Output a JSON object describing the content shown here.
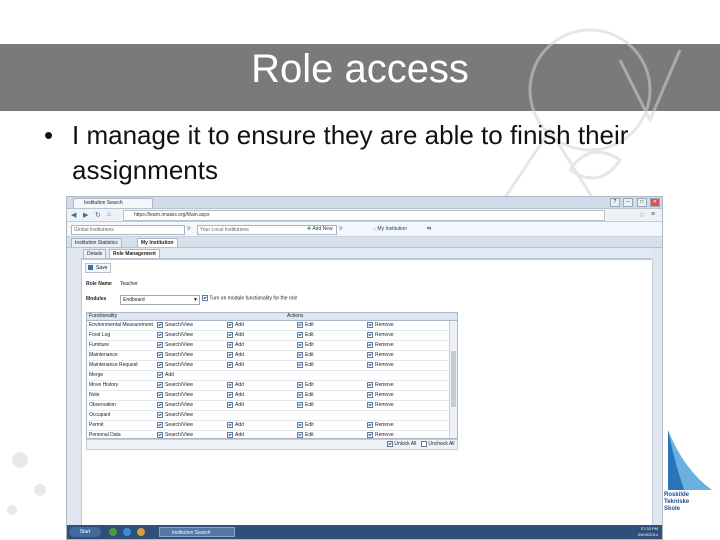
{
  "slide": {
    "title": "Role access",
    "bullet_text": "I manage it to ensure they are able to finish their assignments",
    "logo_lines": [
      "Roskilde",
      "Tekniske",
      "Skole"
    ]
  },
  "browser": {
    "tab_label": "Institution Search",
    "url": "https://learn.imaisis.org/Main.aspx",
    "window_buttons": [
      "?",
      "–",
      "□",
      "✕"
    ]
  },
  "app": {
    "search_global_placeholder": "Global Institutions",
    "search_local_placeholder": "Your Local Institutions",
    "add_new_label": "Add New",
    "my_institution_label": "My Institution",
    "tabs": [
      "Institution Statistics",
      "My Institution"
    ],
    "subtabs": [
      "Details",
      "Role Management"
    ],
    "save_label": "Save",
    "role_name_label": "Role Name",
    "role_name_value": "Teacher",
    "modules_label": "Modules",
    "modules_value": "Endboard",
    "module_toggle_label": "Turn on module functionality for the role",
    "grid_headers": [
      "Functionality",
      "Actions"
    ],
    "rows": [
      {
        "name": "Environmental Measurement",
        "a": "Search/View",
        "b": "Add",
        "c": "Edit",
        "d": "Remove"
      },
      {
        "name": "Food Log",
        "a": "Search/View",
        "b": "Add",
        "c": "Edit",
        "d": "Remove"
      },
      {
        "name": "Furniture",
        "a": "Search/View",
        "b": "Add",
        "c": "Edit",
        "d": "Remove"
      },
      {
        "name": "Maintenance",
        "a": "Search/View",
        "b": "Add",
        "c": "Edit",
        "d": "Remove"
      },
      {
        "name": "Maintenance Request",
        "a": "Search/View",
        "b": "Add",
        "c": "Edit",
        "d": "Remove"
      },
      {
        "name": "Merge",
        "a": "Add",
        "b": "",
        "c": "",
        "d": ""
      },
      {
        "name": "Move History",
        "a": "Search/View",
        "b": "Add",
        "c": "Edit",
        "d": "Remove"
      },
      {
        "name": "Note",
        "a": "Search/View",
        "b": "Add",
        "c": "Edit",
        "d": "Remove"
      },
      {
        "name": "Observation",
        "a": "Search/View",
        "b": "Add",
        "c": "Edit",
        "d": "Remove"
      },
      {
        "name": "Occupant",
        "a": "Search/View",
        "b": "",
        "c": "",
        "d": ""
      },
      {
        "name": "Permit",
        "a": "Search/View",
        "b": "Add",
        "c": "Edit",
        "d": "Remove"
      },
      {
        "name": "Personal Data",
        "a": "Search/View",
        "b": "Add",
        "c": "Edit",
        "d": "Remove"
      }
    ],
    "footer_left": "Unlock All",
    "footer_right": "Uncheck All"
  },
  "taskbar": {
    "start_label": "Start",
    "task_label": "Institution Search",
    "time": "07:33 PM",
    "date": "09/03/2014"
  }
}
